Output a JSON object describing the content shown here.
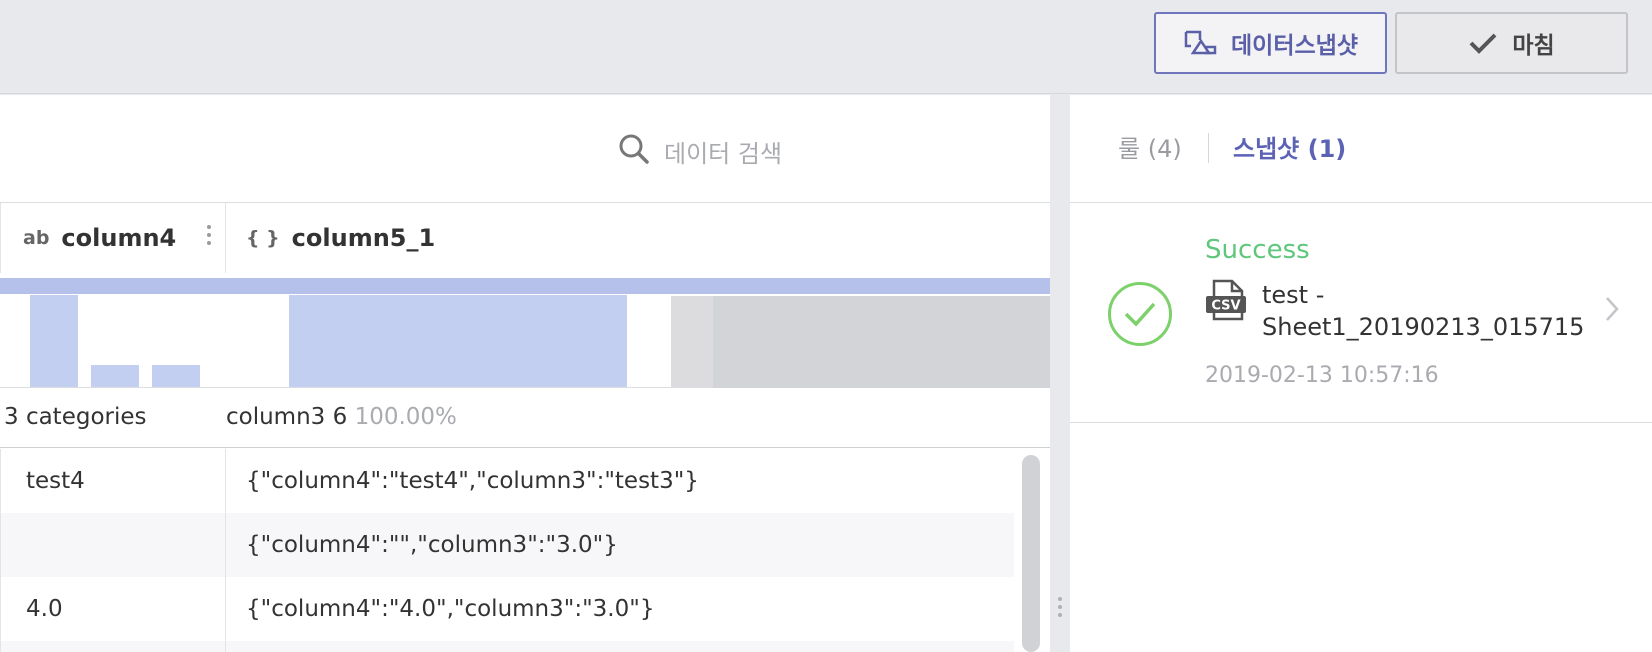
{
  "toolbar": {
    "snapshot_label": "데이터스냅샷",
    "done_label": "마침"
  },
  "search": {
    "placeholder": "데이터 검색"
  },
  "columns": [
    {
      "type_icon": "ab",
      "name": "column4"
    },
    {
      "type_icon": "{ }",
      "name": "column5_1"
    }
  ],
  "summary": {
    "col4": "3 categories",
    "col5_text": "column3 6",
    "col5_pct": "100.00%"
  },
  "rows": [
    {
      "column4": "test4",
      "column5_1": "{\"column4\":\"test4\",\"column3\":\"test3\"}"
    },
    {
      "column4": "",
      "column5_1": "{\"column4\":\"\",\"column3\":\"3.0\"}"
    },
    {
      "column4": "4.0",
      "column5_1": "{\"column4\":\"4.0\",\"column3\":\"3.0\"}"
    }
  ],
  "right_panel": {
    "tab_rule": "룰 (4)",
    "tab_snapshot": "스냅샷 (1)",
    "snapshot": {
      "status": "Success",
      "file_icon_text": "CSV",
      "name": "test - Sheet1_20190213_015715",
      "time": "2019-02-13 10:57:16"
    }
  },
  "colors": {
    "accent": "#5c63b5",
    "success": "#5fc77b",
    "histogram_bar": "#c3cff0"
  }
}
